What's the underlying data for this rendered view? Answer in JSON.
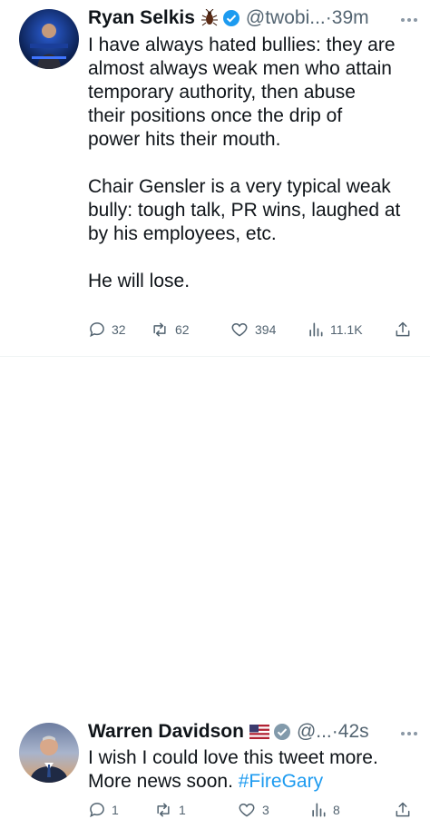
{
  "colors": {
    "accent": "#1d9bf0",
    "text": "#0f1419",
    "muted": "#536471",
    "verified": "#1d9bf0"
  },
  "tweets": [
    {
      "author_name": "Ryan Selkis",
      "author_emoji": "cockroach-icon",
      "handle": "@twobi...",
      "dot": "·",
      "time": "39m",
      "paragraphs": [
        [
          "I have always hated bullies: they are",
          "almost always weak men who attain",
          "temporary authority, then abuse",
          "their positions once the drip of",
          "power hits their mouth."
        ],
        [
          "Chair Gensler is a very typical weak",
          "bully: tough talk, PR wins, laughed at",
          "by his employees, etc."
        ],
        [
          "He will lose."
        ]
      ],
      "stats": {
        "replies": "32",
        "retweets": "62",
        "likes": "394",
        "views": "11.1K"
      }
    },
    {
      "author_name": "Warren Davidson",
      "author_emoji": "us-flag-icon",
      "handle": "@...",
      "dot": "·",
      "time": "42s",
      "lines": [
        "I wish I could love this tweet more.",
        "More news soon. "
      ],
      "hashtag": "#FireGary",
      "stats": {
        "replies": "1",
        "retweets": "1",
        "likes": "3",
        "views": "8"
      }
    }
  ]
}
